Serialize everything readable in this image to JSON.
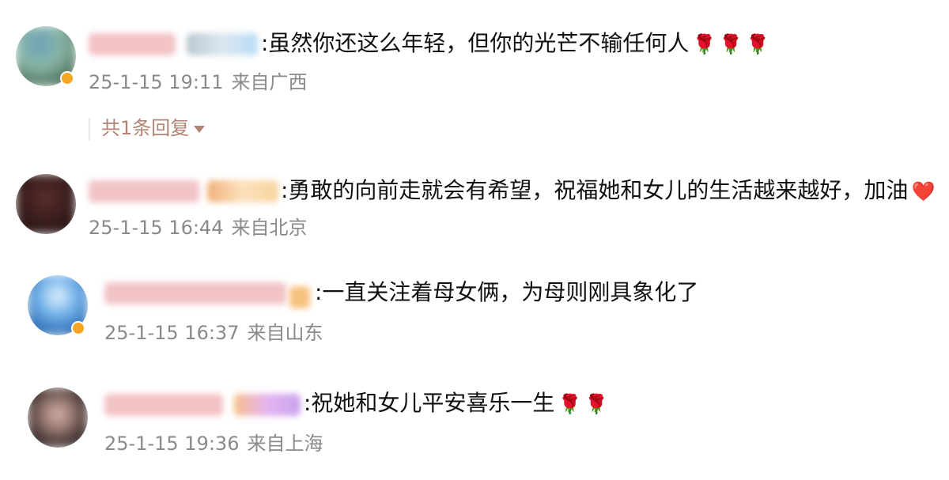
{
  "comments": [
    {
      "text": ":虽然你还这么年轻，但你的光芒不输任何人",
      "emoji": [
        "rose-emoji",
        "rose-emoji",
        "rose-emoji"
      ],
      "date": "25-1-15 19:11",
      "location": "来自广西",
      "reply_label": "共1条回复"
    },
    {
      "text": ":勇敢的向前走就会有希望，祝福她和女儿的生活越来越好，加油",
      "emoji": [
        "heart-emoji"
      ],
      "date": "25-1-15 16:44",
      "location": "来自北京"
    },
    {
      "text": ":一直关注着母女俩，为母则刚具象化了",
      "emoji": [],
      "date": "25-1-15 16:37",
      "location": "来自山东"
    },
    {
      "text": ":祝她和女儿平安喜乐一生",
      "emoji": [
        "rose-emoji",
        "rose-emoji"
      ],
      "date": "25-1-15 19:36",
      "location": "来自上海"
    }
  ],
  "colors": {
    "meta_text": "#8a8a8a",
    "reply_text": "#b38372",
    "badge": "#f5a623"
  }
}
